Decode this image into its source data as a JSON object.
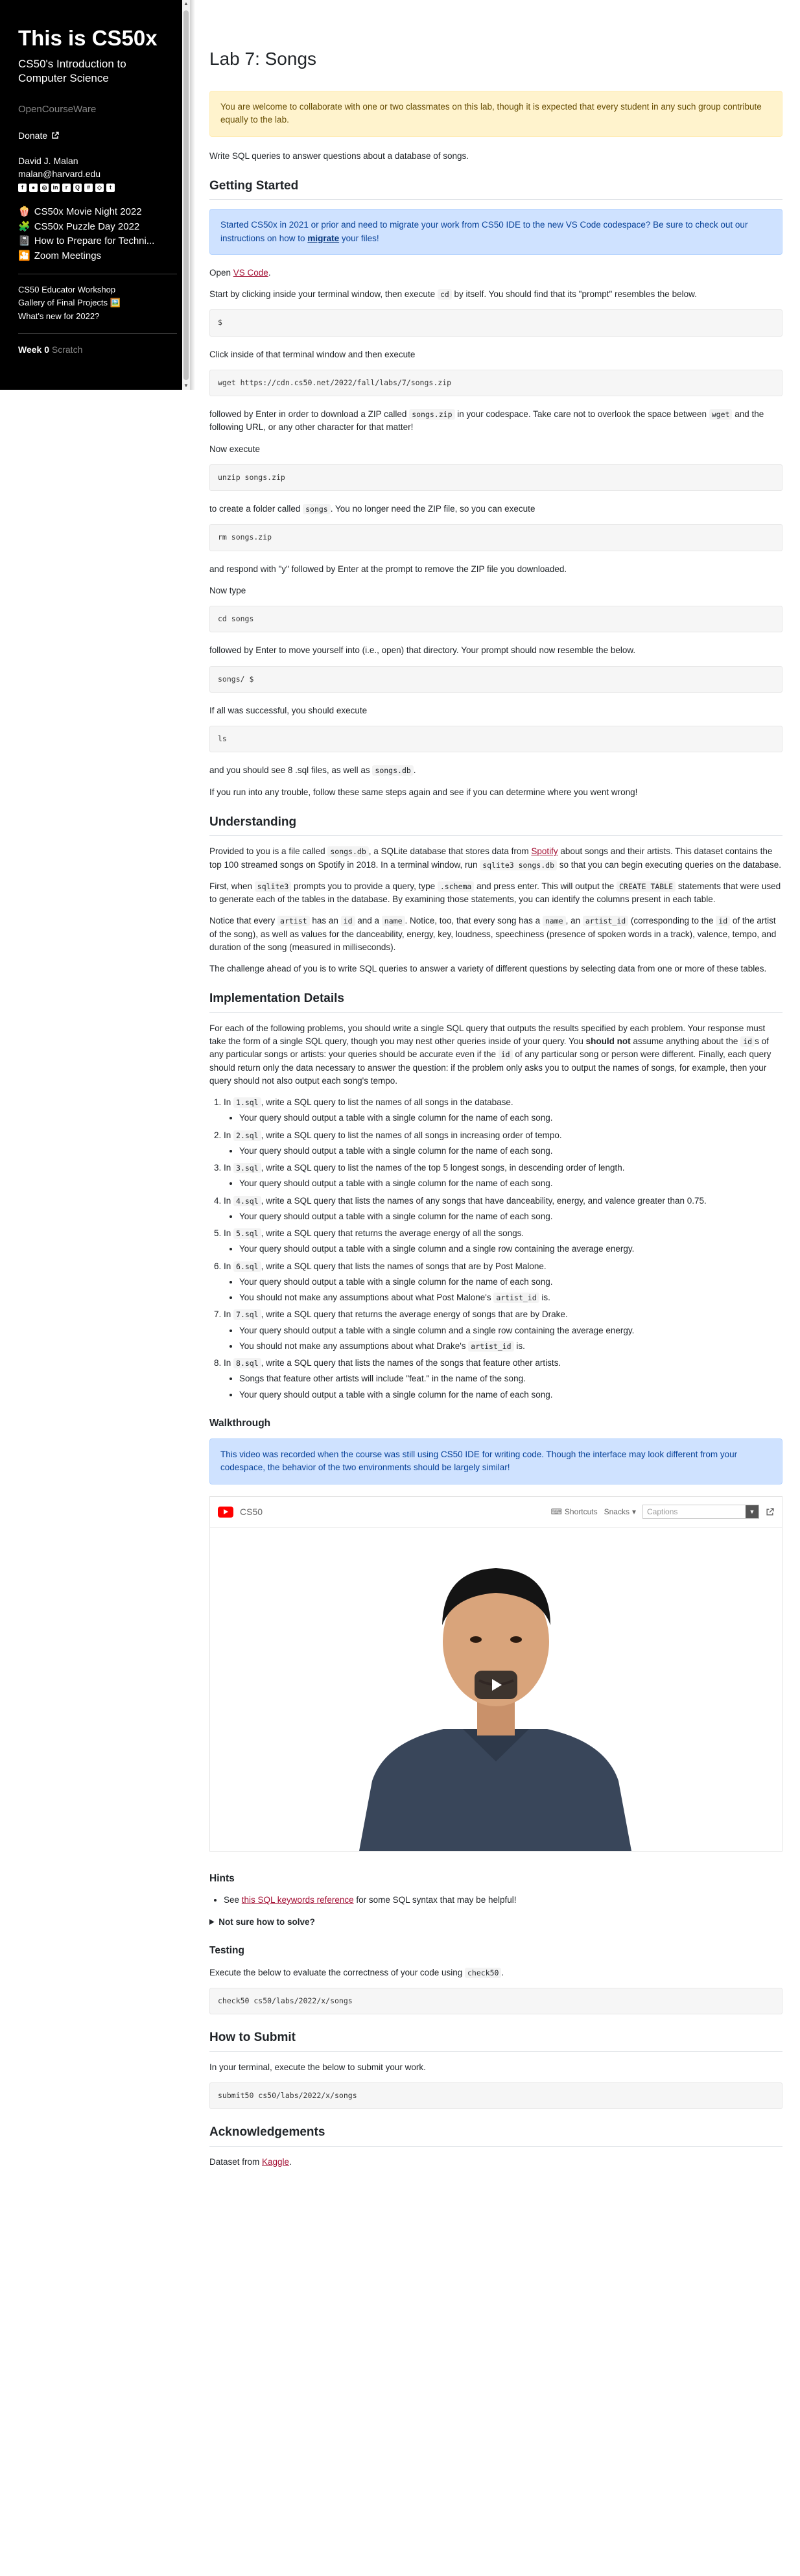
{
  "sidebar": {
    "title": "This is CS50x",
    "subtitle": "CS50's Introduction to Computer Science",
    "ocw": "OpenCourseWare",
    "donate": "Donate",
    "author_name": "David J. Malan",
    "author_email": "malan@harvard.edu",
    "social_icons": [
      "facebook-icon",
      "github-icon",
      "instagram-icon",
      "linkedin-icon",
      "reddit-icon",
      "quora-icon",
      "slack-icon",
      "snapchat-icon",
      "twitter-icon"
    ],
    "links": [
      {
        "icon": "🍿",
        "icon_name": "popcorn-icon",
        "label": "CS50x Movie Night 2022"
      },
      {
        "icon": "🧩",
        "icon_name": "puzzle-icon",
        "label": "CS50x Puzzle Day 2022"
      },
      {
        "icon": "📓",
        "icon_name": "notebook-icon",
        "label": "How to Prepare for Techni..."
      },
      {
        "icon": "🎦",
        "icon_name": "camera-icon",
        "label": "Zoom Meetings"
      }
    ],
    "small_links": [
      "CS50 Educator Workshop",
      "Gallery of Final Projects",
      "What's new for 2022?"
    ],
    "week_label": "Week 0",
    "week_title": "Scratch"
  },
  "main": {
    "title": "Lab 7: Songs",
    "collab_notice": "You are welcome to collaborate with one or two classmates on this lab, though it is expected that every student in any such group contribute equally to the lab.",
    "intro": "Write SQL queries to answer questions about a database of songs.",
    "getting_started": {
      "heading": "Getting Started",
      "migrate_pre": "Started CS50x in 2021 or prior and need to migrate your work from CS50 IDE to the new VS Code codespace? Be sure to check out our instructions on how to ",
      "migrate_link": "migrate",
      "migrate_post": " your files!",
      "open_pre": "Open ",
      "open_link": "VS Code",
      "open_post": ".",
      "p1_pre": "Start by clicking inside your terminal window, then execute ",
      "p1_code": "cd",
      "p1_post": " by itself. You should find that its \"prompt\" resembles the below.",
      "prompt1": "$",
      "p2": "Click inside of that terminal window and then execute",
      "cmd_wget": "wget https://cdn.cs50.net/2022/fall/labs/7/songs.zip",
      "p3_a": "followed by Enter in order to download a ZIP called ",
      "p3_code1": "songs.zip",
      "p3_b": " in your codespace. Take care not to overlook the space between ",
      "p3_code2": "wget",
      "p3_c": " and the following URL, or any other character for that matter!",
      "p4": "Now execute",
      "cmd_unzip": "unzip songs.zip",
      "p5_a": "to create a folder called ",
      "p5_code": "songs",
      "p5_b": ". You no longer need the ZIP file, so you can execute",
      "cmd_rm": "rm songs.zip",
      "p6": "and respond with \"y\" followed by Enter at the prompt to remove the ZIP file you downloaded.",
      "p7": "Now type",
      "cmd_cd": "cd songs",
      "p8": "followed by Enter to move yourself into (i.e., open) that directory. Your prompt should now resemble the below.",
      "prompt2": "songs/ $",
      "p9": "If all was successful, you should execute",
      "cmd_ls": "ls",
      "p10_a": "and you should see 8 .sql files, as well as ",
      "p10_code": "songs.db",
      "p10_b": ".",
      "p11": "If you run into any trouble, follow these same steps again and see if you can determine where you went wrong!"
    },
    "understanding": {
      "heading": "Understanding",
      "u1_a": "Provided to you is a file called ",
      "u1_code1": "songs.db",
      "u1_b": ", a SQLite database that stores data from ",
      "u1_link": "Spotify",
      "u1_c": " about songs and their artists. This dataset contains the top 100 streamed songs on Spotify in 2018. In a terminal window, run ",
      "u1_code2": "sqlite3 songs.db",
      "u1_d": " so that you can begin executing queries on the database.",
      "u2_a": "First, when ",
      "u2_code1": "sqlite3",
      "u2_b": " prompts you to provide a query, type ",
      "u2_code2": ".schema",
      "u2_c": " and press enter. This will output the ",
      "u2_code3": "CREATE TABLE",
      "u2_d": " statements that were used to generate each of the tables in the database. By examining those statements, you can identify the columns present in each table.",
      "u3_a": "Notice that every ",
      "u3_code1": "artist",
      "u3_b": " has an ",
      "u3_code2": "id",
      "u3_c": " and a ",
      "u3_code3": "name",
      "u3_d": ". Notice, too, that every song has a ",
      "u3_code4": "name",
      "u3_e": ", an ",
      "u3_code5": "artist_id",
      "u3_f": " (corresponding to the ",
      "u3_code6": "id",
      "u3_g": " of the artist of the song), as well as values for the danceability, energy, key, loudness, speechiness (presence of spoken words in a track), valence, tempo, and duration of the song (measured in milliseconds).",
      "u4": "The challenge ahead of you is to write SQL queries to answer a variety of different questions by selecting data from one or more of these tables."
    },
    "implementation": {
      "heading": "Implementation Details",
      "i1_a": "For each of the following problems, you should write a single SQL query that outputs the results specified by each problem. Your response must take the form of a single SQL query, though you may nest other queries inside of your query. You ",
      "i1_bold": "should not",
      "i1_b": " assume anything about the ",
      "i1_code1": "id",
      "i1_c": "s of any particular songs or artists: your queries should be accurate even if the ",
      "i1_code2": "id",
      "i1_d": " of any particular song or person were different. Finally, each query should return only the data necessary to answer the question: if the problem only asks you to output the names of songs, for example, then your query should not also output each song's tempo.",
      "items": [
        {
          "pre": "In ",
          "file": "1.sql",
          "post": ", write a SQL query to list the names of all songs in the database.",
          "subs": [
            "Your query should output a table with a single column for the name of each song."
          ]
        },
        {
          "pre": "In ",
          "file": "2.sql",
          "post": ", write a SQL query to list the names of all songs in increasing order of tempo.",
          "subs": [
            "Your query should output a table with a single column for the name of each song."
          ]
        },
        {
          "pre": "In ",
          "file": "3.sql",
          "post": ", write a SQL query to list the names of the top 5 longest songs, in descending order of length.",
          "subs": [
            "Your query should output a table with a single column for the name of each song."
          ]
        },
        {
          "pre": "In ",
          "file": "4.sql",
          "post": ", write a SQL query that lists the names of any songs that have danceability, energy, and valence greater than 0.75.",
          "subs": [
            "Your query should output a table with a single column for the name of each song."
          ]
        },
        {
          "pre": "In ",
          "file": "5.sql",
          "post": ", write a SQL query that returns the average energy of all the songs.",
          "subs": [
            "Your query should output a table with a single column and a single row containing the average energy."
          ]
        },
        {
          "pre": "In ",
          "file": "6.sql",
          "post": ", write a SQL query that lists the names of songs that are by Post Malone.",
          "subs": [
            "Your query should output a table with a single column for the name of each song.",
            "You should not make any assumptions about what Post Malone's ",
            "artist_id",
            " is."
          ]
        },
        {
          "pre": "In ",
          "file": "7.sql",
          "post": ", write a SQL query that returns the average energy of songs that are by Drake.",
          "subs": [
            "Your query should output a table with a single column and a single row containing the average energy.",
            "You should not make any assumptions about what Drake's ",
            "artist_id",
            " is."
          ]
        },
        {
          "pre": "In ",
          "file": "8.sql",
          "post": ", write a SQL query that lists the names of the songs that feature other artists.",
          "subs": [
            "Songs that feature other artists will include \"feat.\" in the name of the song.",
            "Your query should output a table with a single column for the name of each song."
          ]
        }
      ]
    },
    "walkthrough": {
      "heading": "Walkthrough",
      "notice": "This video was recorded when the course was still using CS50 IDE for writing code. Though the interface may look different from your codespace, the behavior of the two environments should be largely similar!",
      "video": {
        "channel": "CS50",
        "shortcuts": "Shortcuts",
        "snacks": "Snacks",
        "captions_placeholder": "Captions"
      }
    },
    "hints": {
      "heading": "Hints",
      "h1_pre": "See ",
      "h1_link": "this SQL keywords reference",
      "h1_post": " for some SQL syntax that may be helpful!",
      "details": "Not sure how to solve?"
    },
    "testing": {
      "heading": "Testing",
      "t1_a": "Execute the below to evaluate the correctness of your code using ",
      "t1_code": "check50",
      "t1_b": ".",
      "cmd": "check50 cs50/labs/2022/x/songs"
    },
    "submit": {
      "heading": "How to Submit",
      "s1": "In your terminal, execute the below to submit your work.",
      "cmd": "submit50 cs50/labs/2022/x/songs"
    },
    "ack": {
      "heading": "Acknowledgements",
      "a1_pre": "Dataset from ",
      "a1_link": "Kaggle",
      "a1_post": "."
    }
  }
}
